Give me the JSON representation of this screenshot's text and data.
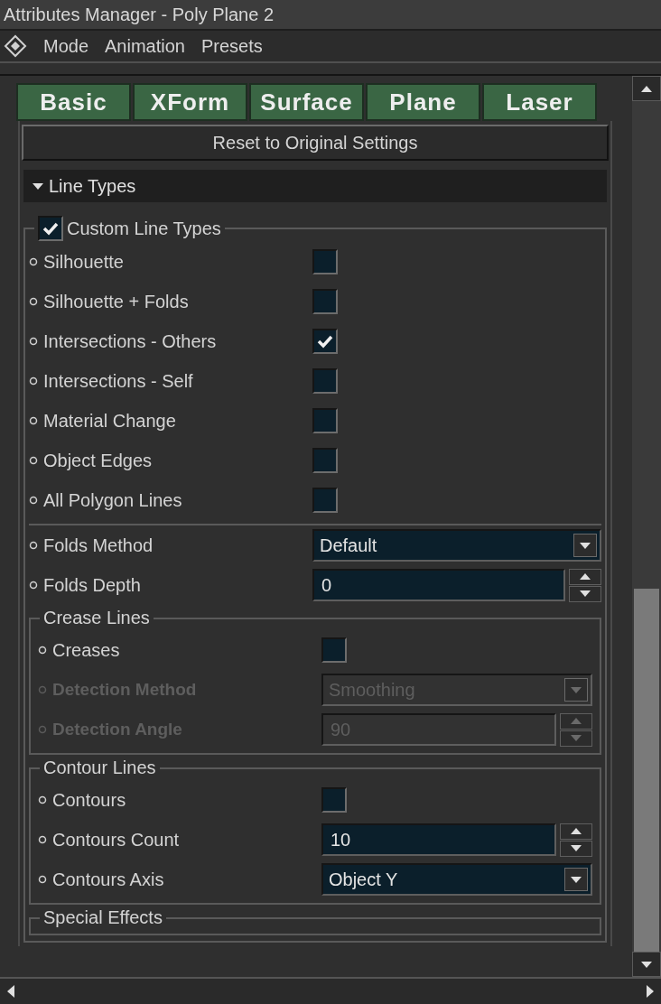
{
  "window": {
    "title": "Attributes Manager - Poly Plane 2"
  },
  "menu": [
    "Mode",
    "Animation",
    "Presets"
  ],
  "tabs": [
    {
      "label": "Basic"
    },
    {
      "label": "XForm"
    },
    {
      "label": "Surface"
    },
    {
      "label": "Plane"
    },
    {
      "label": "Laser"
    }
  ],
  "reset_button": "Reset to Original Settings",
  "section": {
    "title": "Line Types",
    "expanded": true
  },
  "custom_group": {
    "label": "Custom Line Types",
    "checked": true,
    "rows": [
      {
        "label": "Silhouette",
        "checked": false
      },
      {
        "label": "Silhouette + Folds",
        "checked": false
      },
      {
        "label": "Intersections - Others",
        "checked": true
      },
      {
        "label": "Intersections - Self",
        "checked": false
      },
      {
        "label": "Material Change",
        "checked": false
      },
      {
        "label": "Object Edges",
        "checked": false
      },
      {
        "label": "All Polygon Lines",
        "checked": false
      }
    ]
  },
  "params": [
    {
      "kind": "dropdown",
      "label": "Folds Method",
      "value": "Default",
      "disabled": false
    },
    {
      "kind": "spinner",
      "label": "Folds Depth",
      "value": "0",
      "disabled": false
    }
  ],
  "groups": [
    {
      "title": "Crease Lines",
      "rows": [
        {
          "kind": "checkbox",
          "label": "Creases",
          "checked": false,
          "disabled": false
        },
        {
          "kind": "dropdown",
          "label": "Detection Method",
          "value": "Smoothing",
          "disabled": true
        },
        {
          "kind": "spinner",
          "label": "Detection Angle",
          "value": "90",
          "disabled": true
        }
      ]
    },
    {
      "title": "Contour Lines",
      "rows": [
        {
          "kind": "checkbox",
          "label": "Contours",
          "checked": false,
          "disabled": false
        },
        {
          "kind": "spinner",
          "label": "Contours Count",
          "value": "10",
          "disabled": false
        },
        {
          "kind": "dropdown",
          "label": "Contours Axis",
          "value": "Object Y",
          "disabled": false
        }
      ]
    },
    {
      "title": "Special Effects"
    }
  ]
}
